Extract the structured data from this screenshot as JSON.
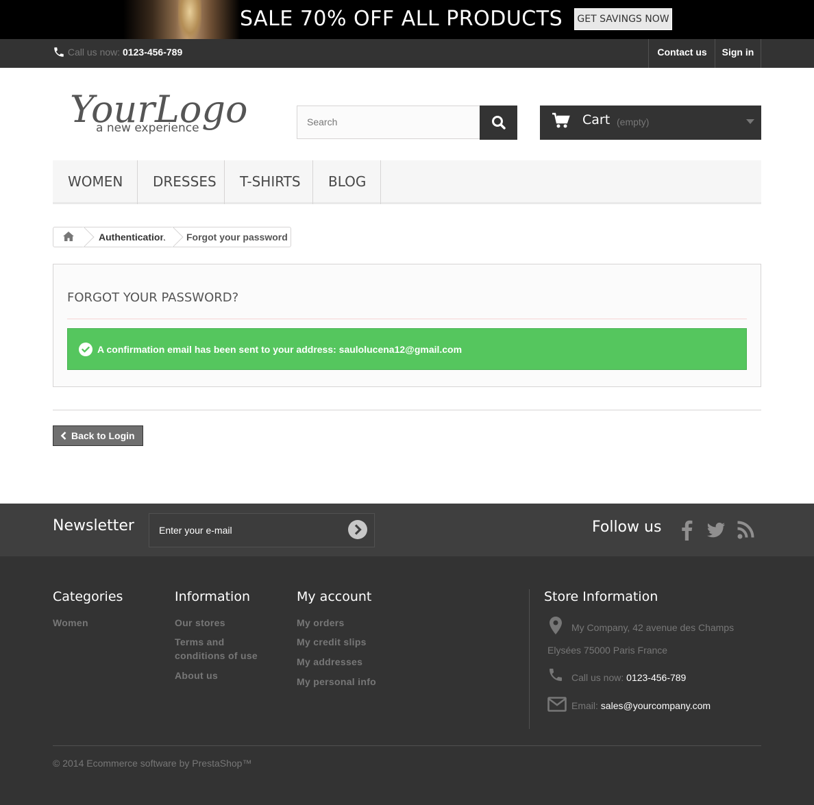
{
  "banner": {
    "text": "SALE 70% OFF ALL PRODUCTS",
    "button": "GET SAVINGS NOW"
  },
  "topbar": {
    "call_label": "Call us now:",
    "phone": "0123-456-789",
    "contact": "Contact us",
    "signin": "Sign in"
  },
  "header": {
    "logo_main": "YourLogo",
    "logo_tagline": "a new experience",
    "search_placeholder": "Search",
    "cart_label": "Cart",
    "cart_status": "(empty)"
  },
  "menu": {
    "items": [
      "WOMEN",
      "DRESSES",
      "T-SHIRTS",
      "BLOG"
    ]
  },
  "breadcrumb": {
    "auth": "Authentication",
    "current": "Forgot your password"
  },
  "main": {
    "heading": "FORGOT YOUR PASSWORD?",
    "alert": "A confirmation email has been sent to your address: saulolucena12@gmail.com",
    "back_button": "Back to Login"
  },
  "footer": {
    "newsletter_title": "Newsletter",
    "newsletter_placeholder": "Enter your e-mail",
    "follow_title": "Follow us",
    "categories": {
      "title": "Categories",
      "links": [
        "Women"
      ]
    },
    "information": {
      "title": "Information",
      "links": [
        "Our stores",
        "Terms and conditions of use",
        "About us"
      ]
    },
    "account": {
      "title": "My account",
      "links": [
        "My orders",
        "My credit slips",
        "My addresses",
        "My personal info"
      ]
    },
    "store": {
      "title": "Store Information",
      "address_line1": "My Company, 42 avenue des Champs",
      "address_line2": "Elysées 75000 Paris France",
      "call_label": "Call us now:",
      "phone": "0123-456-789",
      "email_label": "Email:",
      "email": "sales@yourcompany.com"
    },
    "copyright": "© 2014 Ecommerce software by PrestaShop™"
  },
  "colors": {
    "success": "#55c65e",
    "dark": "#333333",
    "footer_band": "#3f3f3f"
  }
}
